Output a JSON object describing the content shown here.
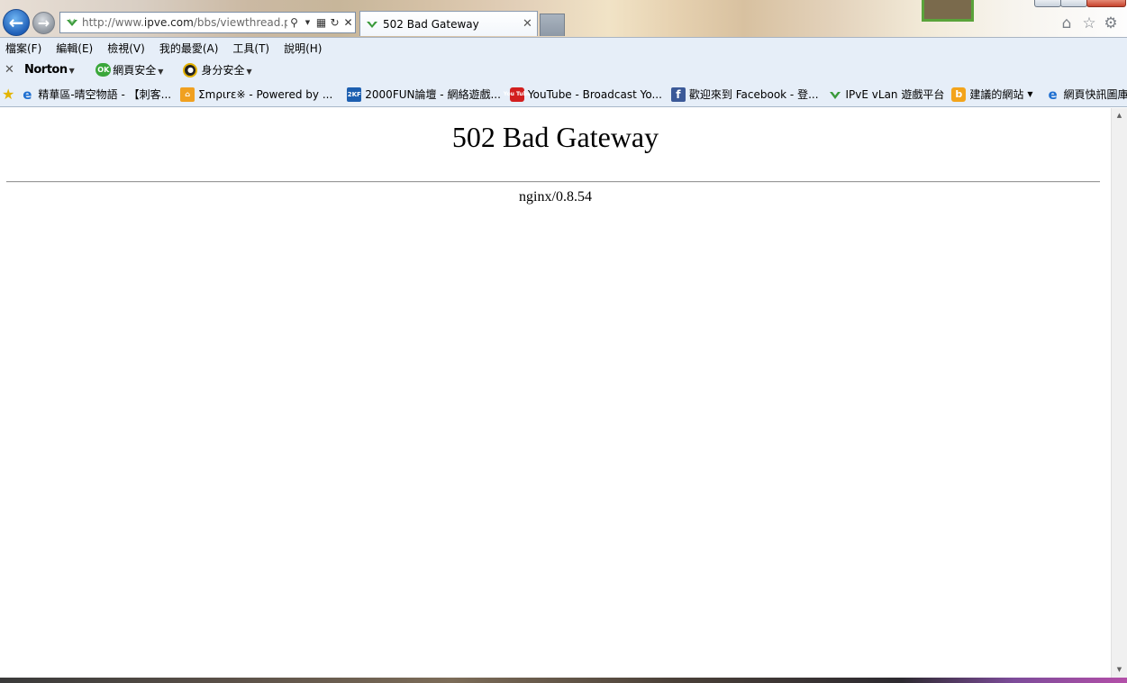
{
  "browser": {
    "address_url_prefix": "http://www.",
    "address_url_domain": "ipve.com",
    "address_url_path": "/bbs/viewthread.p",
    "tab_title": "502 Bad Gateway"
  },
  "menu": {
    "items": [
      "檔案(F)",
      "編輯(E)",
      "檢視(V)",
      "我的最愛(A)",
      "工具(T)",
      "說明(H)"
    ]
  },
  "norton": {
    "logo": "Norton",
    "ok_badge": "OK",
    "web_safety": "網頁安全",
    "identity_safety": "身分安全"
  },
  "favorites": {
    "items": [
      {
        "label": "精華區-晴空物語 - 【刺客...",
        "icon": "ie-icon"
      },
      {
        "label": "Σmριrε※ - Powered by ...",
        "icon": "home-icon"
      },
      {
        "label": "2000FUN論壇 - 網絡遊戲...",
        "icon": "2kf-icon",
        "icon_text": "2KF"
      },
      {
        "label": "YouTube - Broadcast Yo...",
        "icon": "youtube-icon",
        "icon_text": "You Tube"
      },
      {
        "label": "歡迎來到 Facebook - 登...",
        "icon": "facebook-icon",
        "icon_text": "f"
      },
      {
        "label": "IPvE vLan 遊戲平台",
        "icon": "ipve-icon"
      },
      {
        "label": "建議的網站",
        "icon": "bing-icon",
        "icon_text": "b"
      },
      {
        "label": "網頁快訊圖庫",
        "icon": "ie-gallery-icon"
      }
    ]
  },
  "page": {
    "title": "502 Bad Gateway",
    "server": "nginx/0.8.54"
  },
  "colors": {
    "chrome_bg": "#e6eef8",
    "back_button": "#1f5fb8",
    "norton_ok": "#3aa73a"
  }
}
